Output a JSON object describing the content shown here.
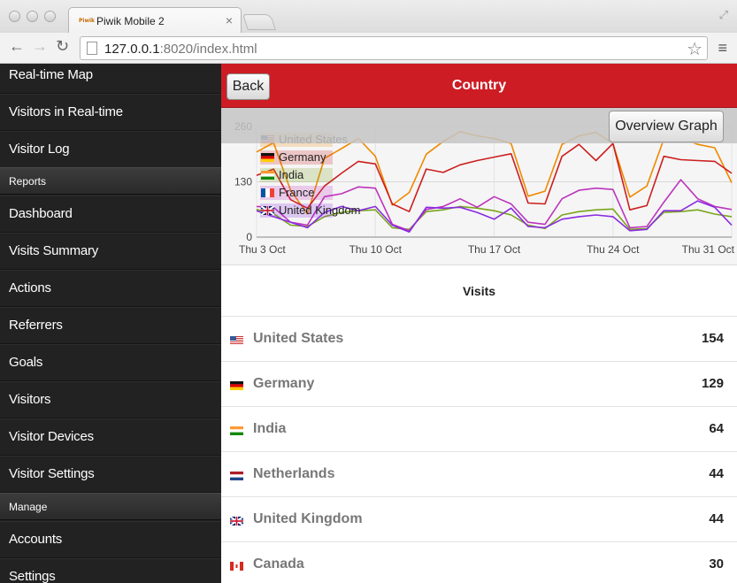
{
  "browser": {
    "tab_title": "Piwik Mobile 2",
    "favicon_text": "Piwik",
    "url_host": "127.0.0.1",
    "url_rest": ":8020/index.html"
  },
  "sidebar": {
    "items_top": [
      "Real-time Map",
      "Visitors in Real-time",
      "Visitor Log"
    ],
    "section_reports": "Reports",
    "items_reports": [
      "Dashboard",
      "Visits Summary",
      "Actions",
      "Referrers",
      "Goals",
      "Visitors",
      "Visitor Devices",
      "Visitor Settings"
    ],
    "section_manage": "Manage",
    "items_manage": [
      "Accounts",
      "Settings"
    ]
  },
  "header": {
    "back_label": "Back",
    "title": "Country"
  },
  "graph": {
    "overview_label": "Overview Graph"
  },
  "chart_data": {
    "type": "line",
    "x": [
      "Thu 3 Oct",
      "Fri 4 Oct",
      "Sat 5 Oct",
      "Sun 6 Oct",
      "Mon 7 Oct",
      "Tue 8 Oct",
      "Wed 9 Oct",
      "Thu 10 Oct",
      "Fri 11 Oct",
      "Sat 12 Oct",
      "Sun 13 Oct",
      "Mon 14 Oct",
      "Tue 15 Oct",
      "Wed 16 Oct",
      "Thu 17 Oct",
      "Fri 18 Oct",
      "Sat 19 Oct",
      "Sun 20 Oct",
      "Mon 21 Oct",
      "Tue 22 Oct",
      "Wed 23 Oct",
      "Thu 24 Oct",
      "Fri 25 Oct",
      "Sat 26 Oct",
      "Sun 27 Oct",
      "Mon 28 Oct",
      "Tue 29 Oct",
      "Wed 30 Oct",
      "Thu 31 Oct"
    ],
    "x_tick_labels": [
      "Thu 3 Oct",
      "Thu 10 Oct",
      "Thu 17 Oct",
      "Thu 24 Oct",
      "Thu 31 Oct"
    ],
    "y_tick_labels": [
      "0",
      "130",
      "260"
    ],
    "ylim": [
      0,
      260
    ],
    "grid": true,
    "legend_position": "top-left",
    "series": [
      {
        "name": "United States",
        "color": "#ef8a00",
        "flag": "us",
        "values": [
          200,
          222,
          110,
          55,
          185,
          208,
          232,
          190,
          75,
          105,
          195,
          225,
          248,
          238,
          232,
          220,
          96,
          108,
          218,
          238,
          246,
          220,
          94,
          120,
          230,
          234,
          218,
          210,
          128
        ]
      },
      {
        "name": "Germany",
        "color": "#cc1f1f",
        "flag": "de",
        "values": [
          145,
          160,
          88,
          68,
          120,
          150,
          178,
          172,
          78,
          60,
          160,
          152,
          170,
          180,
          188,
          196,
          80,
          78,
          190,
          218,
          180,
          220,
          64,
          74,
          190,
          182,
          180,
          178,
          150
        ]
      },
      {
        "name": "India",
        "color": "#7aa61c",
        "flag": "in",
        "values": [
          65,
          55,
          28,
          25,
          48,
          58,
          62,
          64,
          22,
          18,
          60,
          64,
          72,
          68,
          62,
          52,
          28,
          20,
          52,
          60,
          64,
          66,
          18,
          20,
          58,
          60,
          64,
          54,
          48
        ]
      },
      {
        "name": "France",
        "color": "#bd34bd",
        "flag": "fr",
        "values": [
          72,
          70,
          35,
          28,
          95,
          102,
          118,
          115,
          30,
          15,
          65,
          72,
          90,
          70,
          95,
          78,
          35,
          30,
          90,
          110,
          115,
          112,
          22,
          25,
          82,
          135,
          90,
          72,
          65
        ]
      },
      {
        "name": "United Kingdom",
        "color": "#8a2be2",
        "flag": "gb",
        "values": [
          62,
          48,
          35,
          22,
          58,
          72,
          62,
          72,
          28,
          12,
          70,
          68,
          70,
          58,
          42,
          68,
          25,
          22,
          42,
          48,
          52,
          48,
          15,
          18,
          62,
          62,
          85,
          70,
          28
        ]
      }
    ]
  },
  "visits": {
    "title": "Visits",
    "rows": [
      {
        "name": "United States",
        "value": "154",
        "flag": "us"
      },
      {
        "name": "Germany",
        "value": "129",
        "flag": "de"
      },
      {
        "name": "India",
        "value": "64",
        "flag": "in"
      },
      {
        "name": "Netherlands",
        "value": "44",
        "flag": "nl"
      },
      {
        "name": "United Kingdom",
        "value": "44",
        "flag": "gb"
      },
      {
        "name": "Canada",
        "value": "30",
        "flag": "ca"
      }
    ]
  }
}
